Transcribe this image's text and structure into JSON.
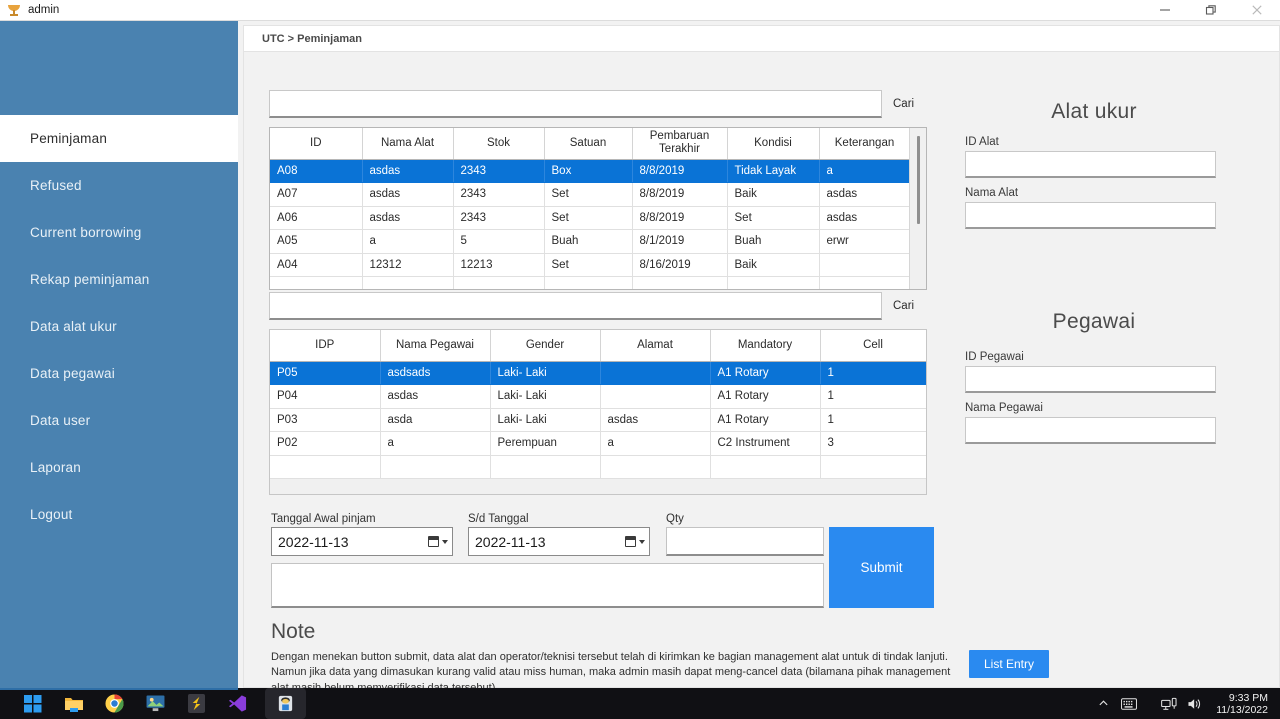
{
  "window": {
    "title": "admin",
    "app_icon": "trophy-icon",
    "controls": {
      "minimize": "minimize-icon",
      "restore": "restore-icon",
      "close": "close-icon"
    }
  },
  "breadcrumb": "UTC > Peminjaman",
  "sidebar": {
    "items": [
      {
        "label": "Peminjaman",
        "active": true
      },
      {
        "label": "Refused",
        "active": false
      },
      {
        "label": "Current borrowing",
        "active": false
      },
      {
        "label": "Rekap peminjaman",
        "active": false
      },
      {
        "label": "Data alat ukur",
        "active": false
      },
      {
        "label": "Data pegawai",
        "active": false
      },
      {
        "label": "Data user",
        "active": false
      },
      {
        "label": "Laporan",
        "active": false
      },
      {
        "label": "Logout",
        "active": false
      }
    ]
  },
  "search_alat": {
    "value": "",
    "placeholder": "",
    "button": "Cari"
  },
  "search_pegawai": {
    "value": "",
    "placeholder": "",
    "button": "Cari"
  },
  "table_alat": {
    "columns": [
      "ID",
      "Nama Alat",
      "Stok",
      "Satuan",
      "Pembaruan Terakhir",
      "Kondisi",
      "Keterangan"
    ],
    "rows": [
      {
        "selected": true,
        "cells": [
          "A08",
          "asdas",
          "2343",
          "Box",
          "8/8/2019",
          "Tidak Layak",
          "a"
        ]
      },
      {
        "selected": false,
        "cells": [
          "A07",
          "asdas",
          "2343",
          "Set",
          "8/8/2019",
          "Baik",
          "asdas"
        ]
      },
      {
        "selected": false,
        "cells": [
          "A06",
          "asdas",
          "2343",
          "Set",
          "8/8/2019",
          "Set",
          "asdas"
        ]
      },
      {
        "selected": false,
        "cells": [
          "A05",
          "a",
          "5",
          "Buah",
          "8/1/2019",
          "Buah",
          "erwr"
        ]
      },
      {
        "selected": false,
        "cells": [
          "A04",
          "12312",
          "12213",
          "Set",
          "8/16/2019",
          "Baik",
          ""
        ]
      },
      {
        "selected": false,
        "cells": [
          "",
          "",
          "",
          "",
          "",
          "",
          ""
        ]
      }
    ]
  },
  "table_pegawai": {
    "columns": [
      "IDP",
      "Nama Pegawai",
      "Gender",
      "Alamat",
      "Mandatory",
      "Cell"
    ],
    "rows": [
      {
        "selected": true,
        "cells": [
          "P05",
          "asdsads",
          "Laki- Laki",
          "",
          "A1 Rotary",
          "1"
        ]
      },
      {
        "selected": false,
        "cells": [
          "P04",
          "asdas",
          "Laki- Laki",
          "",
          "A1 Rotary",
          "1"
        ]
      },
      {
        "selected": false,
        "cells": [
          "P03",
          "asda",
          "Laki- Laki",
          "asdas",
          "A1 Rotary",
          "1"
        ]
      },
      {
        "selected": false,
        "cells": [
          "P02",
          "a",
          "Perempuan",
          "a",
          "C2 Instrument",
          "3"
        ]
      },
      {
        "selected": false,
        "cells": [
          "",
          "",
          "",
          "",
          "",
          ""
        ]
      }
    ]
  },
  "panel_alat_ukur": {
    "title": "Alat ukur",
    "fields": [
      {
        "label": "ID Alat",
        "value": "",
        "placeholder": ""
      },
      {
        "label": "Nama Alat",
        "value": "",
        "placeholder": ""
      }
    ]
  },
  "panel_pegawai": {
    "title": "Pegawai",
    "fields": [
      {
        "label": "ID Pegawai",
        "value": "",
        "placeholder": ""
      },
      {
        "label": "Nama Pegawai",
        "value": "",
        "placeholder": ""
      }
    ]
  },
  "form": {
    "start_date": {
      "label": "Tanggal Awal pinjam",
      "value": "2022-11-13"
    },
    "end_date": {
      "label": "S/d Tanggal",
      "value": "2022-11-13"
    },
    "qty": {
      "label": "Qty",
      "value": "",
      "placeholder": ""
    },
    "notes_box": {
      "value": "",
      "placeholder": ""
    },
    "submit_label": "Submit"
  },
  "note": {
    "title": "Note",
    "body": "Dengan menekan button submit, data alat dan operator/teknisi tersebut telah di kirimkan ke bagian management alat untuk di tindak lanjuti. Namun jika data yang dimasukan kurang valid atau miss human, maka admin masih dapat meng-cancel data (bilamana pihak management alat masih belum memverifikasi data tersebut).",
    "list_entry_label": "List Entry"
  },
  "taskbar": {
    "icons": [
      "windows-start-icon",
      "file-explorer-icon",
      "chrome-icon",
      "photos-icon",
      "sublime-text-icon",
      "vscode-icon",
      "app-window-icon"
    ],
    "tray": [
      "chevron-up-icon",
      "keyboard-icon",
      "network-icon",
      "volume-icon"
    ],
    "time": "9:33 PM",
    "date": "11/13/2022"
  },
  "colors": {
    "sidebar": "#4a82b0",
    "accent": "#2a8af0",
    "selection": "#0a73d6",
    "taskbar": "#101014"
  }
}
